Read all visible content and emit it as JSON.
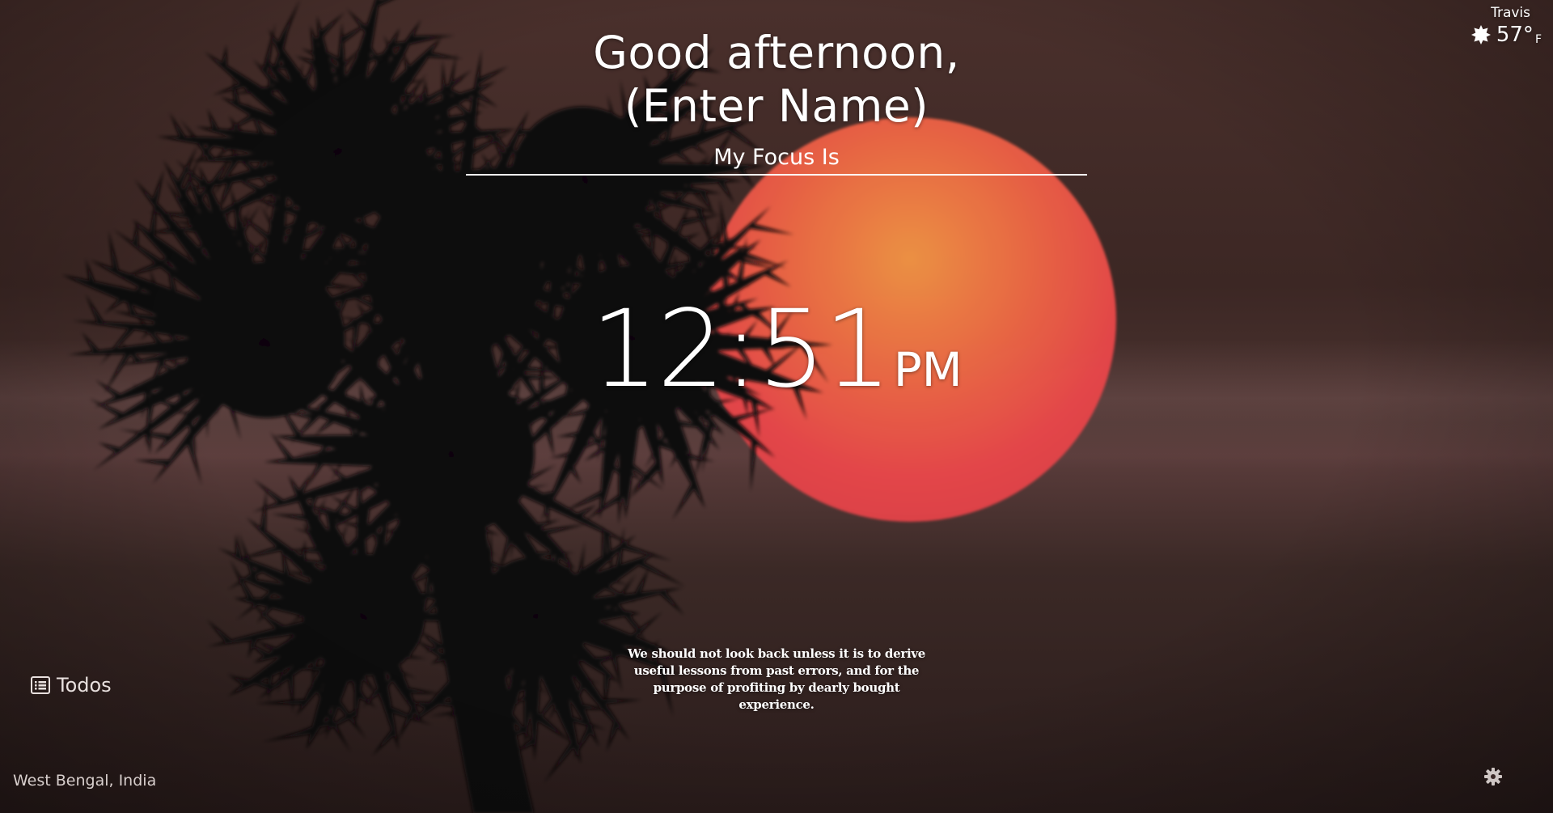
{
  "greeting": {
    "line1": "Good afternoon,",
    "line2": "(Enter Name)"
  },
  "focus": {
    "placeholder": "My Focus Is",
    "value": ""
  },
  "clock": {
    "time": "12:51",
    "ampm": "PM"
  },
  "quote": {
    "text": "We should not look back unless it is to derive useful lessons from past errors, and for the purpose of profiting by dearly bought experience."
  },
  "weather": {
    "city": "Travis",
    "temperature": "57°",
    "unit": "F",
    "icon": "sun-icon"
  },
  "todos": {
    "label": "Todos",
    "icon": "list-icon"
  },
  "location": {
    "text": "West Bengal, India"
  },
  "settings": {
    "icon": "gear-icon"
  },
  "background": {
    "subject": "palm tree silhouette at sunset",
    "colors": {
      "sky": "#3c2724",
      "sun": "#e9474a",
      "sun_top": "#f39545",
      "silhouette": "#0c0708"
    }
  }
}
